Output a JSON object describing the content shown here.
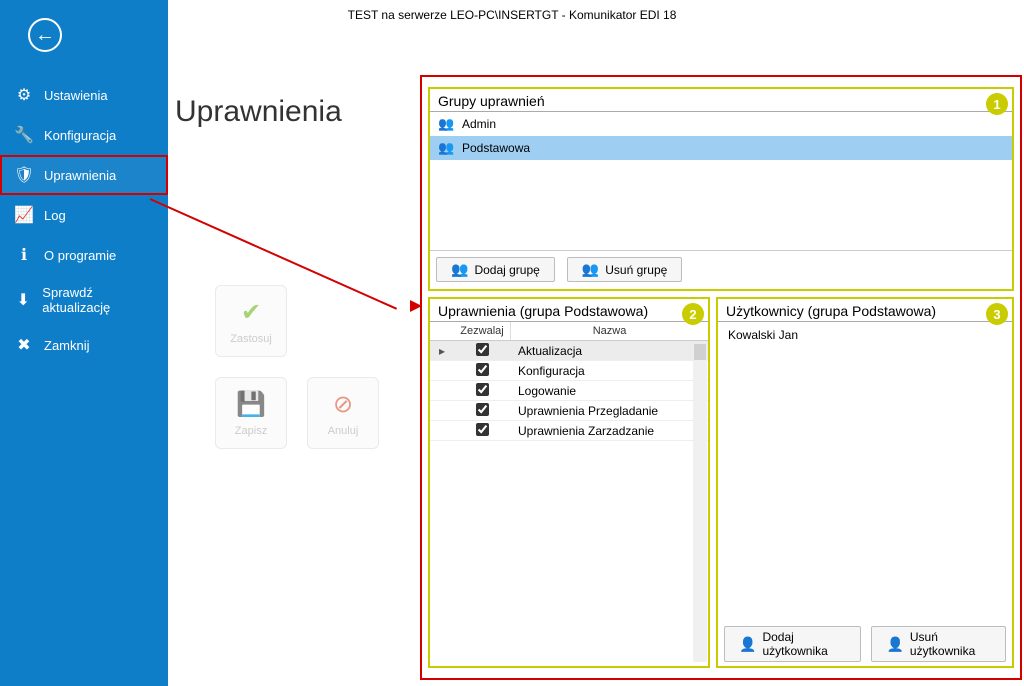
{
  "app_title": "TEST na serwerze LEO-PC\\INSERTGT - Komunikator EDI 18",
  "page_heading": "Uprawnienia",
  "sidebar": {
    "items": [
      {
        "icon": "⚙",
        "label": "Ustawienia"
      },
      {
        "icon": "🔧",
        "label": "Konfiguracja"
      },
      {
        "icon": "🛡",
        "label": "Uprawnienia",
        "selected": true
      },
      {
        "icon": "📈",
        "label": "Log"
      },
      {
        "icon": "ℹ",
        "label": "O programie"
      },
      {
        "icon": "⬇",
        "label": "Sprawdź aktualizację"
      },
      {
        "icon": "✖",
        "label": "Zamknij"
      }
    ]
  },
  "actions": {
    "apply": {
      "label": "Zastosuj",
      "glyph": "✔"
    },
    "save": {
      "label": "Zapisz",
      "glyph": "💾"
    },
    "cancel": {
      "label": "Anuluj",
      "glyph": "⊘"
    }
  },
  "groups_panel": {
    "title": "Grupy uprawnień",
    "badge": "1",
    "rows": [
      {
        "name": "Admin",
        "selected": false
      },
      {
        "name": "Podstawowa",
        "selected": true
      }
    ],
    "add_btn": "Dodaj grupę",
    "del_btn": "Usuń grupę"
  },
  "perms_panel": {
    "title": "Uprawnienia (grupa Podstawowa)",
    "badge": "2",
    "col_allow": "Zezwalaj",
    "col_name": "Nazwa",
    "rows": [
      {
        "allow": true,
        "name": "Aktualizacja",
        "current": true
      },
      {
        "allow": true,
        "name": "Konfiguracja"
      },
      {
        "allow": true,
        "name": "Logowanie"
      },
      {
        "allow": true,
        "name": "Uprawnienia Przegladanie"
      },
      {
        "allow": true,
        "name": "Uprawnienia Zarzadzanie"
      }
    ]
  },
  "users_panel": {
    "title": "Użytkownicy (grupa Podstawowa)",
    "badge": "3",
    "rows": [
      {
        "name": "Kowalski Jan"
      }
    ],
    "add_btn": "Dodaj użytkownika",
    "del_btn": "Usuń użytkownika"
  }
}
